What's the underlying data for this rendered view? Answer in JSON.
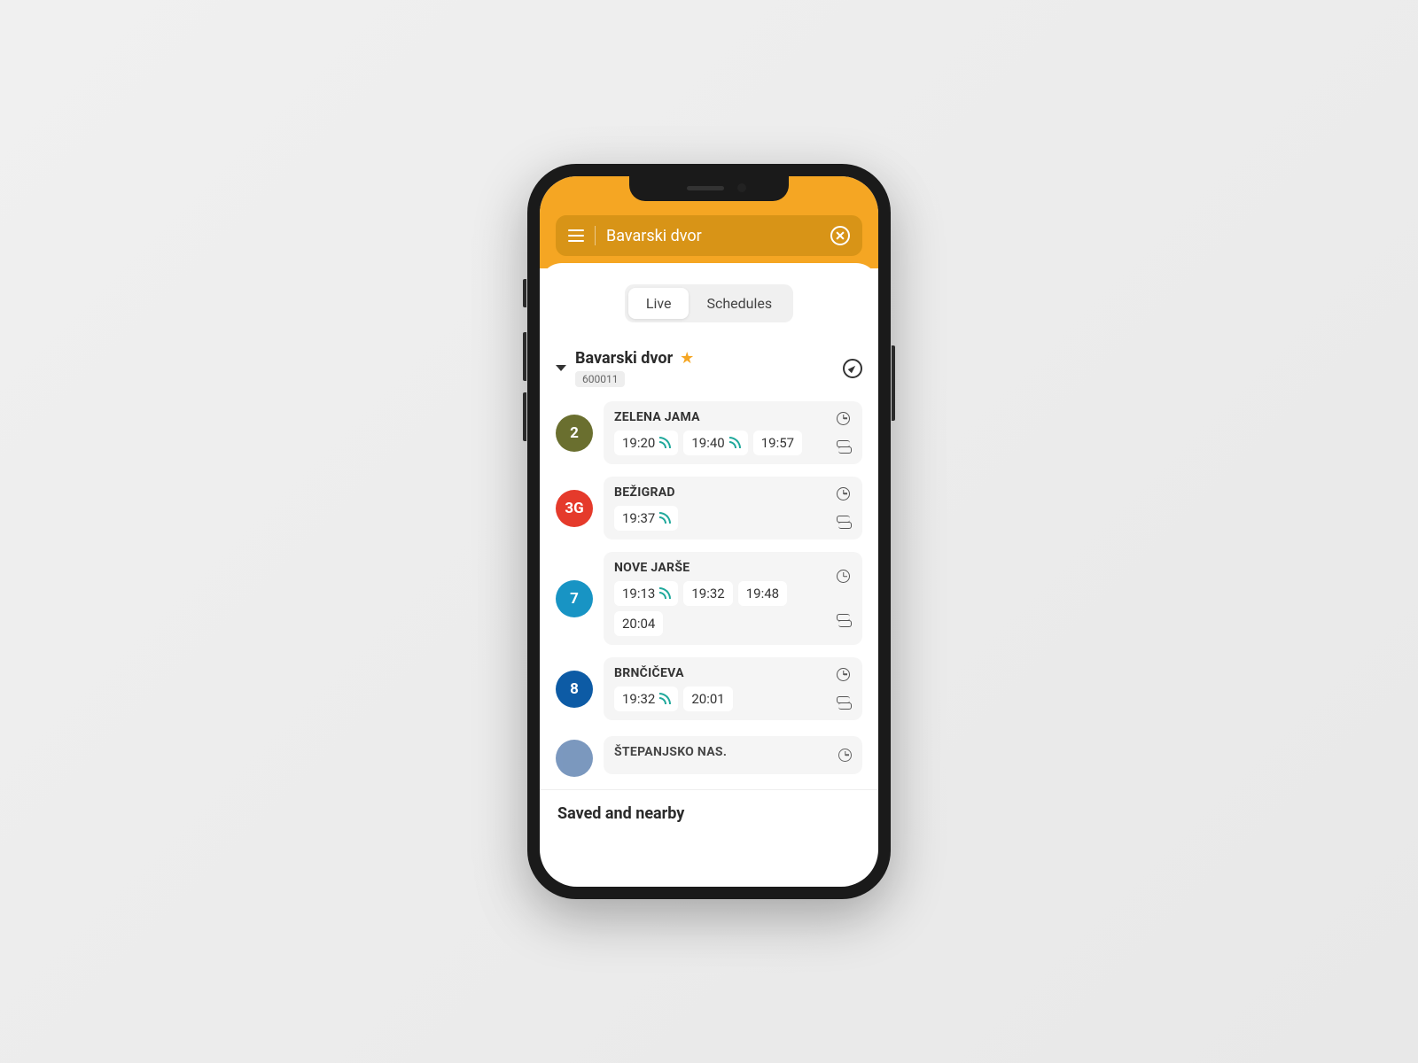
{
  "header": {
    "search_value": "Bavarski dvor"
  },
  "tabs": {
    "live": "Live",
    "schedules": "Schedules",
    "active": "live"
  },
  "station": {
    "name": "Bavarski dvor",
    "code": "600011",
    "favorite": true
  },
  "routes": [
    {
      "number": "2",
      "color": "#6a6f2f",
      "destination": "ZELENA JAMA",
      "times": [
        {
          "time": "19:20",
          "live": true
        },
        {
          "time": "19:40",
          "live": true
        },
        {
          "time": "19:57",
          "live": false
        }
      ]
    },
    {
      "number": "3G",
      "color": "#e53a2b",
      "destination": "BEŽIGRAD",
      "times": [
        {
          "time": "19:37",
          "live": true
        }
      ]
    },
    {
      "number": "7",
      "color": "#1894c4",
      "destination": "NOVE JARŠE",
      "times": [
        {
          "time": "19:13",
          "live": true
        },
        {
          "time": "19:32",
          "live": false
        },
        {
          "time": "19:48",
          "live": false
        },
        {
          "time": "20:04",
          "live": false
        }
      ]
    },
    {
      "number": "8",
      "color": "#0d5ba5",
      "destination": "BRNČIČEVA",
      "times": [
        {
          "time": "19:32",
          "live": true
        },
        {
          "time": "20:01",
          "live": false
        }
      ]
    },
    {
      "number": "",
      "color": "#6d8db8",
      "destination": "ŠTEPANJSKO NAS.",
      "times": []
    }
  ],
  "footer": {
    "title": "Saved and nearby"
  }
}
